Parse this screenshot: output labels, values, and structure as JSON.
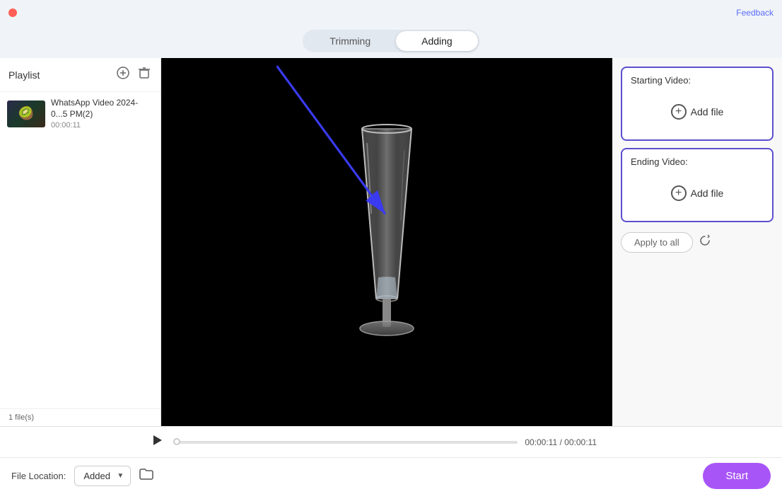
{
  "topBar": {
    "feedbackLabel": "Feedback"
  },
  "tabs": {
    "trimming": "Trimming",
    "adding": "Adding",
    "activeTab": "Adding"
  },
  "sidebar": {
    "title": "Playlist",
    "fileCount": "1 file(s)",
    "items": [
      {
        "name": "WhatsApp Video 2024-0...5 PM(2)",
        "duration": "00:00:11",
        "emoji": "🥝"
      }
    ]
  },
  "rightPanel": {
    "startingVideoLabel": "Starting Video:",
    "endingVideoLabel": "Ending Video:",
    "addFileLabel": "Add file",
    "applyToAllLabel": "Apply to all"
  },
  "playerBar": {
    "currentTime": "00:00:11",
    "separator": "/",
    "totalTime": "00:00:11"
  },
  "bottomBar": {
    "fileLocationLabel": "File Location:",
    "locationValue": "Added",
    "startLabel": "Start"
  }
}
